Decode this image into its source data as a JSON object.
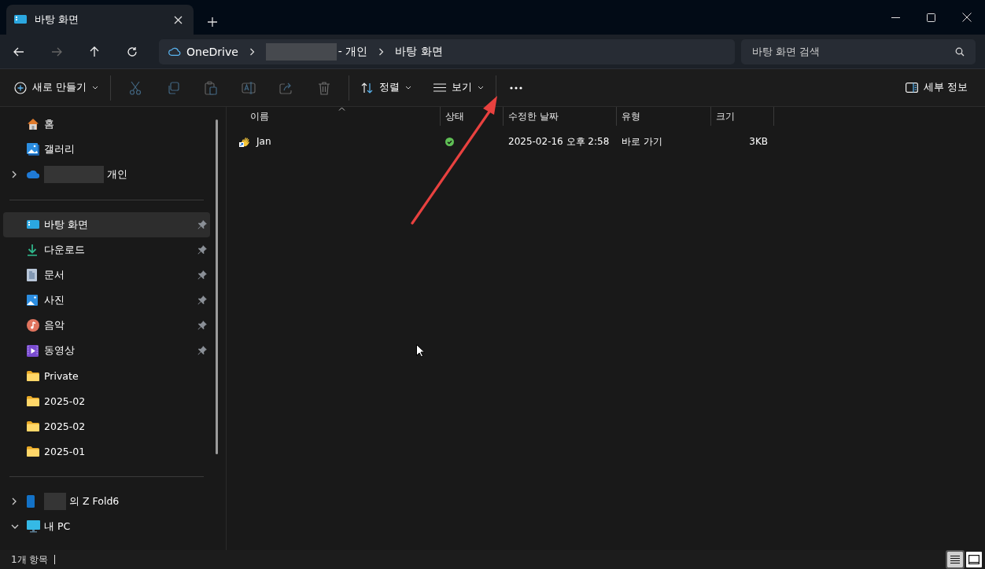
{
  "window": {
    "tab": {
      "title": "바탕 화면"
    }
  },
  "address_bar": {
    "segments": [
      {
        "kind": "cloud",
        "label": "OneDrive"
      },
      {
        "kind": "redacted",
        "label": "- 개인"
      },
      {
        "kind": "plain",
        "label": "바탕 화면"
      }
    ]
  },
  "search": {
    "placeholder": "바탕 화면 검색"
  },
  "toolbar": {
    "new_label": "새로 만들기",
    "actions": [
      {
        "kind": "cut",
        "disabled": true
      },
      {
        "kind": "copy",
        "disabled": true
      },
      {
        "kind": "paste",
        "disabled": true
      },
      {
        "kind": "rename",
        "disabled": true
      },
      {
        "kind": "share",
        "disabled": true
      },
      {
        "kind": "delete",
        "disabled": true
      }
    ],
    "sort_label": "정렬",
    "view_label": "보기",
    "details_label": "세부 정보"
  },
  "sidebar": {
    "sections": [
      {
        "items": [
          {
            "kind": "home",
            "label": "홈",
            "pinned": false,
            "selected": false
          },
          {
            "kind": "gallery",
            "label": "갤러리",
            "pinned": false,
            "selected": false
          },
          {
            "kind": "onedrive",
            "label": "개인",
            "redacted": true,
            "expanded": false,
            "pinned": false,
            "selected": false
          }
        ]
      },
      {
        "items": [
          {
            "kind": "desktop",
            "label": "바탕 화면",
            "pinned": true,
            "selected": true
          },
          {
            "kind": "download",
            "label": "다운로드",
            "pinned": true,
            "selected": false
          },
          {
            "kind": "documents",
            "label": "문서",
            "pinned": true,
            "selected": false
          },
          {
            "kind": "pictures",
            "label": "사진",
            "pinned": true,
            "selected": false
          },
          {
            "kind": "music",
            "label": "음악",
            "pinned": true,
            "selected": false
          },
          {
            "kind": "videos",
            "label": "동영상",
            "pinned": true,
            "selected": false
          },
          {
            "kind": "folder",
            "label": "Private",
            "pinned": false,
            "selected": false
          },
          {
            "kind": "folder",
            "label": "2025-02",
            "pinned": false,
            "selected": false
          },
          {
            "kind": "folder",
            "label": "2025-02",
            "pinned": false,
            "selected": false
          },
          {
            "kind": "folder",
            "label": "2025-01",
            "pinned": false,
            "selected": false
          }
        ]
      },
      {
        "items": [
          {
            "kind": "phone",
            "label": "의 Z Fold6",
            "redacted": true,
            "expanded": false,
            "pinned": false,
            "selected": false
          },
          {
            "kind": "pc",
            "label": "내 PC",
            "expanded": true,
            "pinned": false,
            "selected": false
          }
        ]
      }
    ]
  },
  "file_list": {
    "columns": [
      {
        "label": "이름",
        "sorted": true
      },
      {
        "label": "상태",
        "sorted": false
      },
      {
        "label": "수정한 날짜",
        "sorted": false
      },
      {
        "label": "유형",
        "sorted": false
      },
      {
        "label": "크기",
        "sorted": false
      }
    ],
    "rows": [
      {
        "name": "Jan",
        "synced": true,
        "modified": "2025-02-16 오후 2:58",
        "type": "바로 가기",
        "size": "3KB"
      }
    ]
  },
  "status_bar": {
    "count": "1개 항목",
    "views": [
      {
        "kind": "details",
        "selected": true
      },
      {
        "kind": "preview",
        "selected": false
      }
    ]
  },
  "annotations": [
    {
      "kind": "arrow",
      "color": "#e8413f"
    }
  ]
}
